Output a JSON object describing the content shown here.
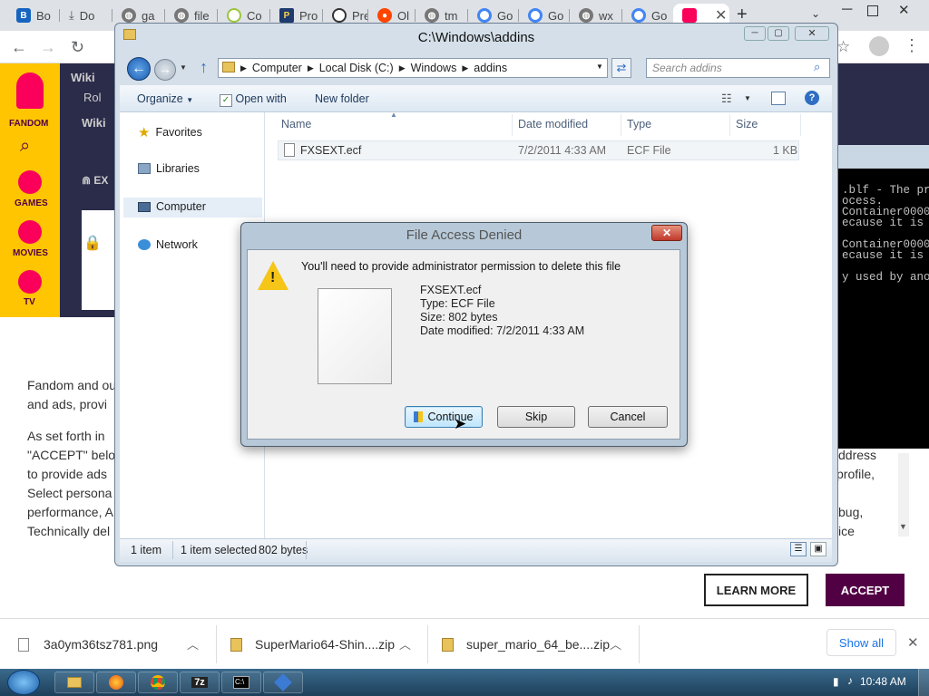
{
  "browser": {
    "tabs": [
      {
        "label": "Bo",
        "favicon": "B"
      },
      {
        "label": "Do",
        "favicon": "download-icon"
      },
      {
        "label": "ga",
        "favicon": "globe-icon"
      },
      {
        "label": "file",
        "favicon": "globe-icon"
      },
      {
        "label": "Co",
        "favicon": "O"
      },
      {
        "label": "Pro",
        "favicon": "P"
      },
      {
        "label": "Pre",
        "favicon": "clock-icon"
      },
      {
        "label": "Ol",
        "favicon": "reddit-icon"
      },
      {
        "label": "tm",
        "favicon": "globe-icon"
      },
      {
        "label": "Go",
        "favicon": "google-icon"
      },
      {
        "label": "Go",
        "favicon": "google-icon"
      },
      {
        "label": "wx",
        "favicon": "globe-icon"
      },
      {
        "label": "Go",
        "favicon": "google-icon"
      },
      {
        "label": "",
        "favicon": "fandom-icon"
      }
    ]
  },
  "fandom": {
    "logo_label": "FANDOM",
    "rail": [
      "GAMES",
      "MOVIES",
      "TV"
    ],
    "wiki_label_1": "Wiki",
    "wiki_label_2": "Wiki",
    "ex_label": "EX",
    "hero_img_alt": "Rol"
  },
  "consent": {
    "lines": [
      "Fandom and ou",
      "and ads, provi",
      "As set forth in",
      "\"ACCEPT\" belo",
      "to provide ads",
      "Select persona",
      "performance, A",
      "Technically del"
    ],
    "right_fragments": [
      "ddress",
      "profile,",
      "bug,",
      "ice"
    ],
    "learn_more": "LEARN MORE",
    "accept": "ACCEPT"
  },
  "downloads": {
    "items": [
      {
        "name": "3a0ym36tsz781.png"
      },
      {
        "name": "SuperMario64-Shin....zip"
      },
      {
        "name": "super_mario_64_be....zip"
      }
    ],
    "show_all": "Show all"
  },
  "cmd": {
    "lines": [
      ".blf - The pr",
      "ocess.",
      "Container0000",
      "ecause it is",
      "",
      "Container0000",
      "ecause it is",
      "",
      "y used by ano"
    ]
  },
  "explorer": {
    "title": "C:\\Windows\\addins",
    "breadcrumb": [
      "Computer",
      "Local Disk (C:)",
      "Windows",
      "addins"
    ],
    "search_placeholder": "Search addins",
    "commands": {
      "organize": "Organize",
      "open_with": "Open with",
      "new_folder": "New folder"
    },
    "nav": [
      "Favorites",
      "Libraries",
      "Computer",
      "Network"
    ],
    "columns": {
      "name": "Name",
      "date": "Date modified",
      "type": "Type",
      "size": "Size"
    },
    "file": {
      "name": "FXSEXT.ecf",
      "date": "7/2/2011 4:33 AM",
      "type": "ECF File",
      "size": "1 KB"
    },
    "status": {
      "count": "1 item",
      "selected": "1 item selected",
      "bytes": "802 bytes"
    }
  },
  "dialog": {
    "title": "File Access Denied",
    "message": "You'll need to provide administrator permission to delete this file",
    "file_name": "FXSEXT.ecf",
    "file_type": "Type: ECF File",
    "file_size": "Size: 802 bytes",
    "file_date": "Date modified: 7/2/2011 4:33 AM",
    "buttons": {
      "continue": "Continue",
      "skip": "Skip",
      "cancel": "Cancel"
    }
  },
  "taskbar": {
    "clock": "10:48 AM",
    "items": [
      "ie",
      "firefox",
      "chrome",
      "7z",
      "cmd",
      "box"
    ]
  },
  "colors": {
    "fandom_yellow": "#ffc500",
    "accept_purple": "#520044",
    "taskbar": "#2a5272"
  }
}
